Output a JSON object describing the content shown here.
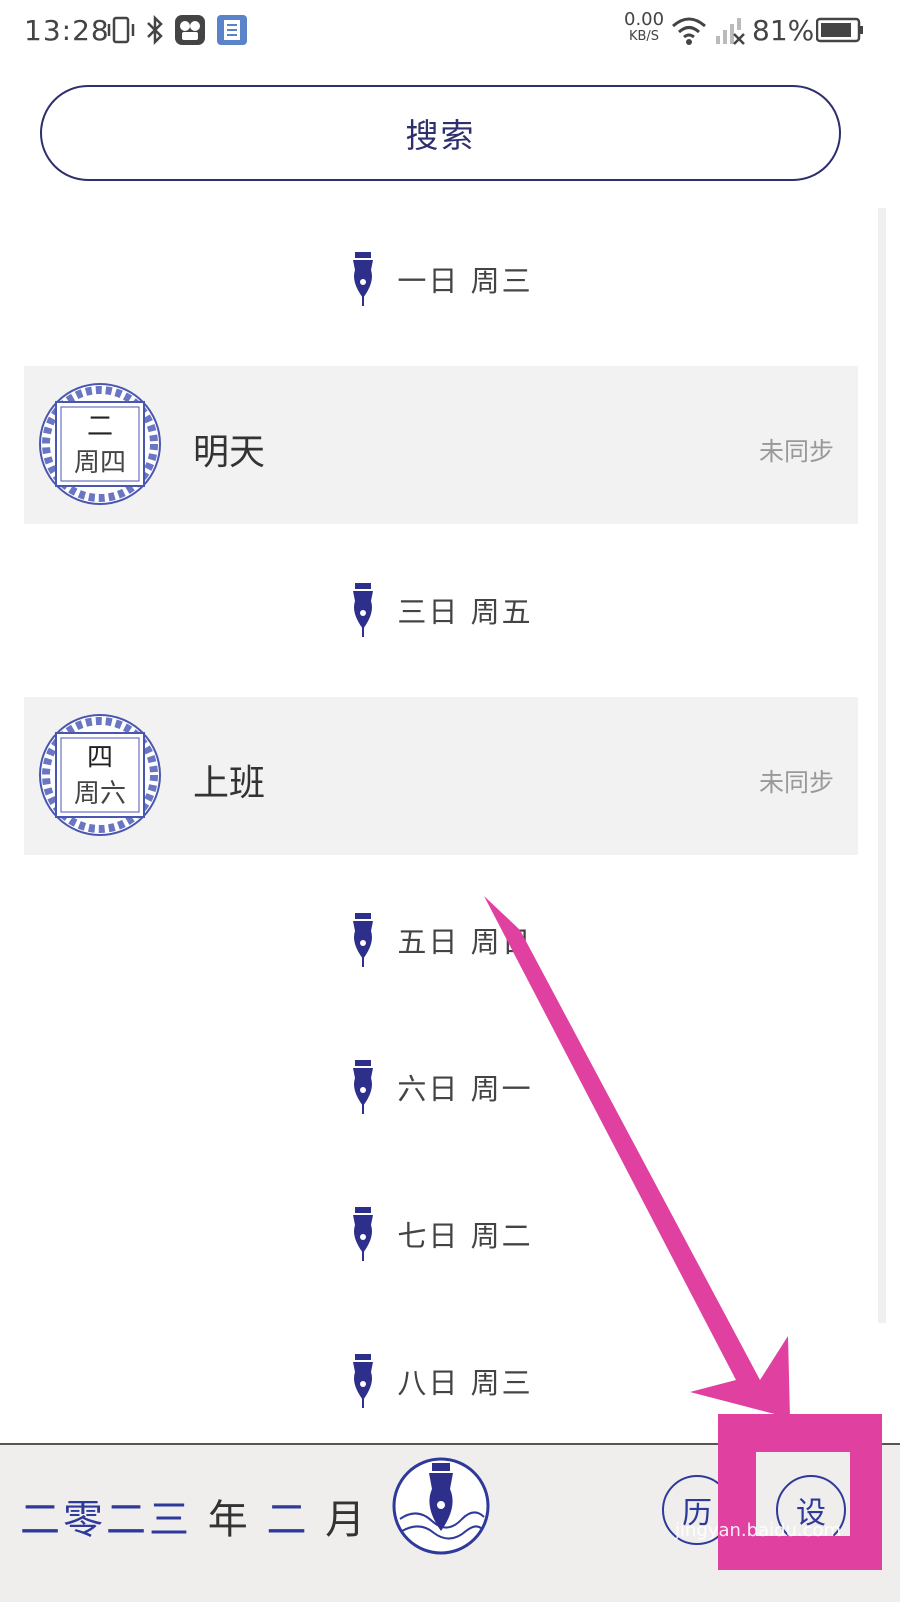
{
  "status_bar": {
    "time": "13:28",
    "net_speed_value": "0.00",
    "net_speed_unit": "KB/S",
    "battery": "81%",
    "icons": [
      "vibrate-icon",
      "bluetooth-icon",
      "app-notification-icon",
      "notes-notification-icon",
      "wifi-icon",
      "signal-icon",
      "battery-icon"
    ]
  },
  "search": {
    "label": "搜索"
  },
  "list": {
    "items": [
      {
        "type": "day",
        "text": "一日 周三"
      },
      {
        "type": "event",
        "badge_day": "二",
        "badge_week": "周四",
        "title": "明天",
        "status": "未同步"
      },
      {
        "type": "day",
        "text": "三日 周五"
      },
      {
        "type": "event",
        "badge_day": "四",
        "badge_week": "周六",
        "title": "上班",
        "status": "未同步"
      },
      {
        "type": "day",
        "text": "五日 周日"
      },
      {
        "type": "day",
        "text": "六日 周一"
      },
      {
        "type": "day",
        "text": "七日 周二"
      },
      {
        "type": "day",
        "text": "八日 周三"
      }
    ]
  },
  "bottom_bar": {
    "month_parts": [
      "二零二三",
      "年",
      "二",
      "月"
    ],
    "left_button_label": "历",
    "right_button_label": "设"
  },
  "annotation": {
    "watermark": "jingyan.baidu.com"
  },
  "colors": {
    "accent": "#2e3a9a",
    "annotation": "#e040a0",
    "row_bg": "#f2f2f2"
  }
}
